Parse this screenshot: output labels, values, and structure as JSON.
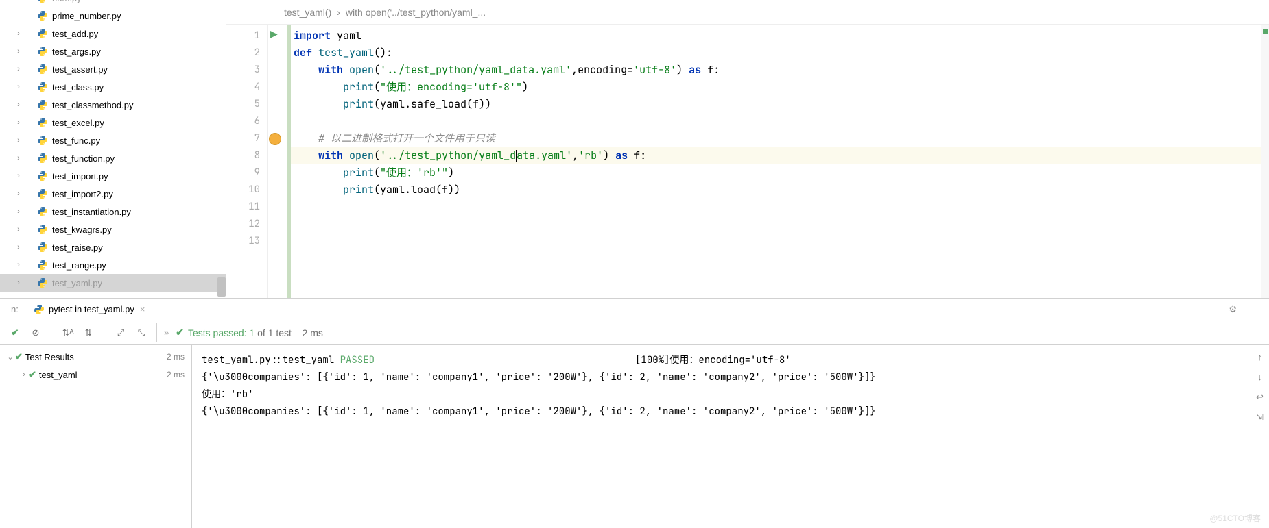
{
  "sidebar": {
    "files": [
      {
        "name": "num.py",
        "expand": false,
        "indent": 1,
        "cutoff_top": true
      },
      {
        "name": "prime_number.py",
        "expand": false,
        "indent": 1
      },
      {
        "name": "test_add.py",
        "expand": true,
        "indent": 1
      },
      {
        "name": "test_args.py",
        "expand": true,
        "indent": 1
      },
      {
        "name": "test_assert.py",
        "expand": true,
        "indent": 1
      },
      {
        "name": "test_class.py",
        "expand": true,
        "indent": 1
      },
      {
        "name": "test_classmethod.py",
        "expand": true,
        "indent": 1
      },
      {
        "name": "test_excel.py",
        "expand": true,
        "indent": 1
      },
      {
        "name": "test_func.py",
        "expand": true,
        "indent": 1
      },
      {
        "name": "test_function.py",
        "expand": true,
        "indent": 1
      },
      {
        "name": "test_import.py",
        "expand": true,
        "indent": 1
      },
      {
        "name": "test_import2.py",
        "expand": true,
        "indent": 1
      },
      {
        "name": "test_instantiation.py",
        "expand": true,
        "indent": 1
      },
      {
        "name": "test_kwagrs.py",
        "expand": true,
        "indent": 1
      },
      {
        "name": "test_raise.py",
        "expand": true,
        "indent": 1
      },
      {
        "name": "test_range.py",
        "expand": true,
        "indent": 1
      },
      {
        "name": "test_yaml.py",
        "expand": true,
        "indent": 1,
        "selected": true,
        "cutoff_bottom": true
      }
    ]
  },
  "breadcrumb": {
    "part1": "test_yaml()",
    "sep": "›",
    "part2": "with open('../test_python/yaml_..."
  },
  "code": {
    "lines": [
      {
        "n": 1,
        "type": "code",
        "html": "<span class='kw'>import</span> <span class='ident'>yaml</span>"
      },
      {
        "n": 2,
        "type": "code",
        "html": "<span class='kw'>def</span> <span class='fn'>test_yaml</span>():"
      },
      {
        "n": 3,
        "type": "code",
        "html": "    <span class='kw'>with</span> <span class='fn'>open</span>(<span class='str'>'../test_python/yaml_data.yaml'</span>,<span class='ident'>encoding</span>=<span class='str'>'utf-8'</span>) <span class='kw'>as</span> f:"
      },
      {
        "n": 4,
        "type": "code",
        "html": "        <span class='fn'>print</span>(<span class='str'>\"使用：encoding='utf-8'\"</span>)"
      },
      {
        "n": 5,
        "type": "code",
        "html": "        <span class='fn'>print</span>(yaml.safe_load(f))"
      },
      {
        "n": 6,
        "type": "code",
        "html": ""
      },
      {
        "n": 7,
        "type": "code",
        "html": "    <span class='cmt'># 以二进制格式打开一个文件用于只读</span>"
      },
      {
        "n": 8,
        "type": "code",
        "hl": true,
        "html": "    <span class='kw'>with</span> <span class='fn'>open</span>(<span class='str'>'../test_python/yaml_d</span><span class='caret'></span><span class='str'>ata.yaml'</span>,<span class='str'>'rb'</span>) <span class='kw'>as</span> f:"
      },
      {
        "n": 9,
        "type": "code",
        "html": "        <span class='fn'>print</span>(<span class='str'>\"使用：'rb'\"</span>)"
      },
      {
        "n": 10,
        "type": "code",
        "html": "        <span class='fn'>print</span>(yaml.load(f))"
      },
      {
        "n": 11,
        "type": "code",
        "html": ""
      },
      {
        "n": 12,
        "type": "code",
        "html": ""
      },
      {
        "n": 13,
        "type": "code",
        "html": ""
      }
    ]
  },
  "run_tab": {
    "prefix": "n:",
    "label": "pytest in test_yaml.py"
  },
  "toolbar": {
    "status_prefix": "Tests passed: 1",
    "status_suffix": " of 1 test – 2 ms"
  },
  "results": {
    "root": {
      "label": "Test Results",
      "time": "2 ms"
    },
    "child": {
      "label": "test_yaml",
      "time": "2 ms"
    }
  },
  "console": {
    "lines": [
      {
        "text": "test_yaml.py::test_yaml ",
        "pass": "PASSED",
        "pct": "[100%]",
        "tail": "使用：encoding='utf-8'"
      },
      {
        "text": "{'\\u3000companies': [{'id': 1, 'name': 'company1', 'price': '200W'}, {'id': 2, 'name': 'company2', 'price': '500W'}]}"
      },
      {
        "text": "使用：'rb'"
      },
      {
        "text": "{'\\u3000companies': [{'id': 1, 'name': 'company1', 'price': '200W'}, {'id': 2, 'name': 'company2', 'price': '500W'}]}"
      }
    ]
  },
  "watermark": "@51CTO博客"
}
